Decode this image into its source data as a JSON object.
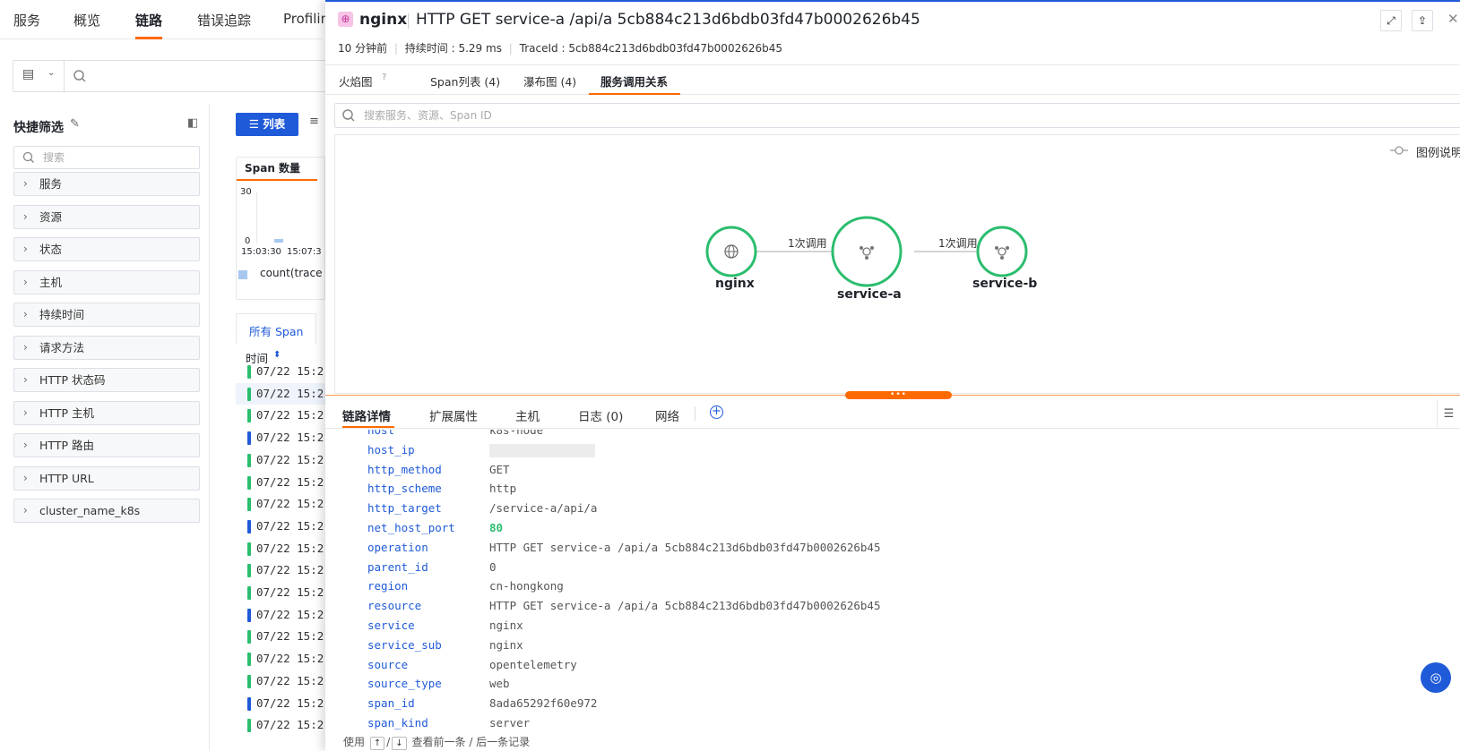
{
  "topnav": {
    "items": [
      "服务",
      "概览",
      "链路",
      "错误追踪",
      "Profilin"
    ]
  },
  "sidebar": {
    "title": "快捷筛选",
    "search_placeholder": "搜索",
    "facets": [
      "服务",
      "资源",
      "状态",
      "主机",
      "持续时间",
      "请求方法",
      "HTTP 状态码",
      "HTTP 主机",
      "HTTP 路由",
      "HTTP URL",
      "cluster_name_k8s"
    ]
  },
  "listview": {
    "list_button": "列表",
    "chart_tab": "Span 数量",
    "chart_ymax": "30",
    "chart_ymin": "0",
    "chart_x1": "15:03:30",
    "chart_x2": "15:07:3",
    "chart_legend": "count(trace",
    "span_tab": "所有 Span",
    "time_header": "时间",
    "rows": [
      {
        "time": "07/22 15:2",
        "color": "#2bbd6e"
      },
      {
        "time": "07/22 15:2",
        "color": "#2bbd6e"
      },
      {
        "time": "07/22 15:2",
        "color": "#2bbd6e"
      },
      {
        "time": "07/22 15:2",
        "color": "#1f5ad8"
      },
      {
        "time": "07/22 15:2",
        "color": "#2bbd6e"
      },
      {
        "time": "07/22 15:2",
        "color": "#2bbd6e"
      },
      {
        "time": "07/22 15:2",
        "color": "#2bbd6e"
      },
      {
        "time": "07/22 15:2",
        "color": "#1f5ad8"
      },
      {
        "time": "07/22 15:2",
        "color": "#2bbd6e"
      },
      {
        "time": "07/22 15:2",
        "color": "#2bbd6e"
      },
      {
        "time": "07/22 15:2",
        "color": "#2bbd6e"
      },
      {
        "time": "07/22 15:2",
        "color": "#1f5ad8"
      },
      {
        "time": "07/22 15:2",
        "color": "#2bbd6e"
      },
      {
        "time": "07/22 15:2",
        "color": "#2bbd6e"
      },
      {
        "time": "07/22 15:2",
        "color": "#2bbd6e"
      },
      {
        "time": "07/22 15:2",
        "color": "#1f5ad8"
      },
      {
        "time": "07/22 15:2",
        "color": "#2bbd6e"
      }
    ]
  },
  "drawer": {
    "service": "nginx",
    "title": "HTTP GET service-a /api/a 5cb884c213d6bdb03fd47b0002626b45",
    "time_ago": "10 分钟前",
    "duration": "持续时间 : 5.29 ms",
    "trace_id": "TraceId : 5cb884c213d6bdb03fd47b0002626b45",
    "tabs": [
      "火焰图",
      "Span列表 (4)",
      "瀑布图 (4)",
      "服务调用关系"
    ],
    "search_placeholder": "搜索服务、资源、Span ID",
    "legend_label": "图例说明",
    "graph": {
      "nodes": [
        "nginx",
        "service-a",
        "service-b"
      ],
      "edges": [
        "1次调用",
        "1次调用"
      ]
    },
    "detail_tabs": [
      "链路详情",
      "扩展属性",
      "主机",
      "日志 (0)",
      "网络"
    ],
    "attributes": [
      {
        "key": "host",
        "value": "k8s-node"
      },
      {
        "key": "host_ip",
        "value": ""
      },
      {
        "key": "http_method",
        "value": "GET"
      },
      {
        "key": "http_scheme",
        "value": "http"
      },
      {
        "key": "http_target",
        "value": "/service-a/api/a"
      },
      {
        "key": "net_host_port",
        "value": "80"
      },
      {
        "key": "operation",
        "value": "HTTP GET service-a /api/a 5cb884c213d6bdb03fd47b0002626b45"
      },
      {
        "key": "parent_id",
        "value": "0"
      },
      {
        "key": "region",
        "value": "cn-hongkong"
      },
      {
        "key": "resource",
        "value": "HTTP GET service-a /api/a 5cb884c213d6bdb03fd47b0002626b45"
      },
      {
        "key": "service",
        "value": "nginx"
      },
      {
        "key": "service_sub",
        "value": "nginx"
      },
      {
        "key": "source",
        "value": "opentelemetry"
      },
      {
        "key": "source_type",
        "value": "web"
      },
      {
        "key": "span_id",
        "value": "8ada65292f60e972"
      },
      {
        "key": "span_kind",
        "value": "server"
      }
    ],
    "footer_use": "使用",
    "footer_up": "↑",
    "footer_sep": "/",
    "footer_down": "↓",
    "footer_hint": "查看前一条 / 后一条记录"
  },
  "colors": {
    "accent": "#ff6a00",
    "brand": "#1f5ad8",
    "node": "#2bbd6e"
  }
}
